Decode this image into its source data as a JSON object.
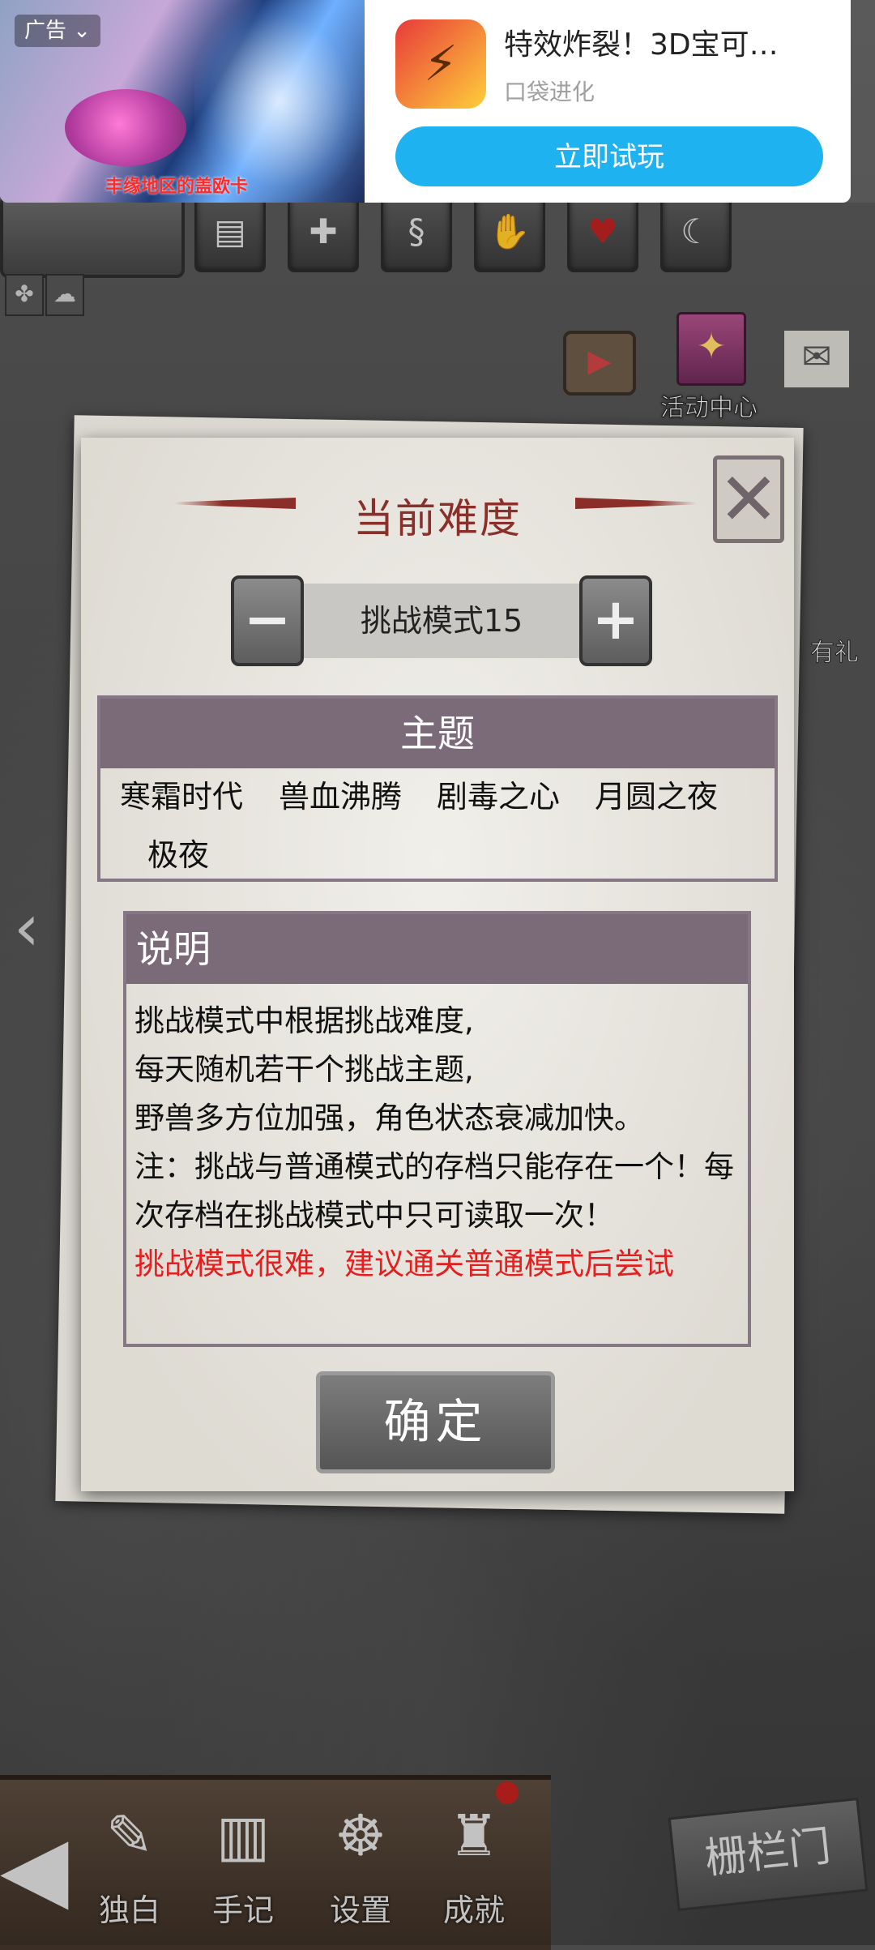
{
  "ad": {
    "tag": "广告",
    "image_caption": "丰缘地区的盖欧卡",
    "title": "特效炸裂！3D宝可…",
    "subtitle": "口袋进化",
    "cta": "立即试玩"
  },
  "background": {
    "gift_label": "活动中心",
    "right_gift_label": "有礼"
  },
  "dialog": {
    "title": "当前难度",
    "difficulty_value": "挑战模式15",
    "theme": {
      "header": "主题",
      "items": [
        "寒霜时代",
        "兽血沸腾",
        "剧毒之心",
        "月圆之夜",
        "极夜"
      ]
    },
    "description": {
      "header": "说明",
      "lines": [
        "挑战模式中根据挑战难度,",
        "每天随机若干个挑战主题,",
        "野兽多方位加强，角色状态衰减加快。",
        "注：挑战与普通模式的存档只能存在一个！每",
        "次存档在挑战模式中只可读取一次！"
      ],
      "warning": "挑战模式很难，建议通关普通模式后尝试"
    },
    "confirm": "确定"
  },
  "bottom_nav": {
    "items": [
      "独白",
      "手记",
      "设置",
      "成就"
    ],
    "gate_label": "栅栏门"
  },
  "colors": {
    "title_red": "#8a2f2a",
    "section_header": "#7b6b79",
    "warning": "#e51f1f",
    "ad_cta": "#1eb2f0"
  }
}
